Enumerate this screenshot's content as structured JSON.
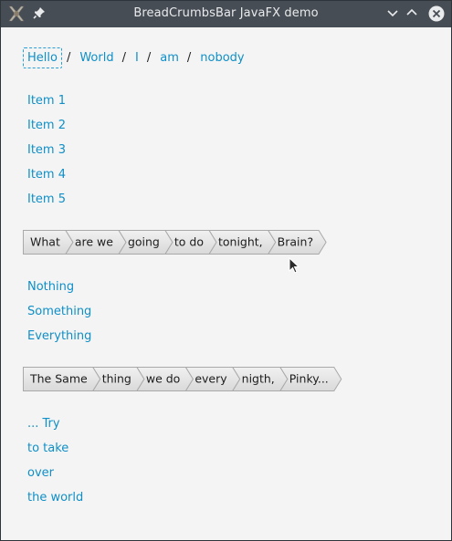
{
  "window": {
    "title": "BreadCrumbsBar JavaFX demo"
  },
  "titlebar_icons": [
    "app-icon",
    "pin-icon",
    "minimize-chevron-icon",
    "maximize-chevron-icon",
    "close-icon"
  ],
  "colors": {
    "link": "#0f8fc7",
    "titlebar": "#474d55",
    "background": "#f4f4f4"
  },
  "breadcrumbs": {
    "items": [
      "Hello",
      "World",
      "I",
      "am",
      "nobody"
    ],
    "separator": "/"
  },
  "list1": [
    "Item 1",
    "Item 2",
    "Item 3",
    "Item 4",
    "Item 5"
  ],
  "bar1": [
    "What",
    "are we",
    "going",
    "to do",
    "tonight,",
    "Brain?"
  ],
  "list2": [
    "Nothing",
    "Something",
    "Everything"
  ],
  "bar2": [
    "The Same",
    "thing",
    "we do",
    "every",
    "nigth,",
    "Pinky..."
  ],
  "list3": [
    "... Try",
    "to take",
    "over",
    "the world"
  ]
}
